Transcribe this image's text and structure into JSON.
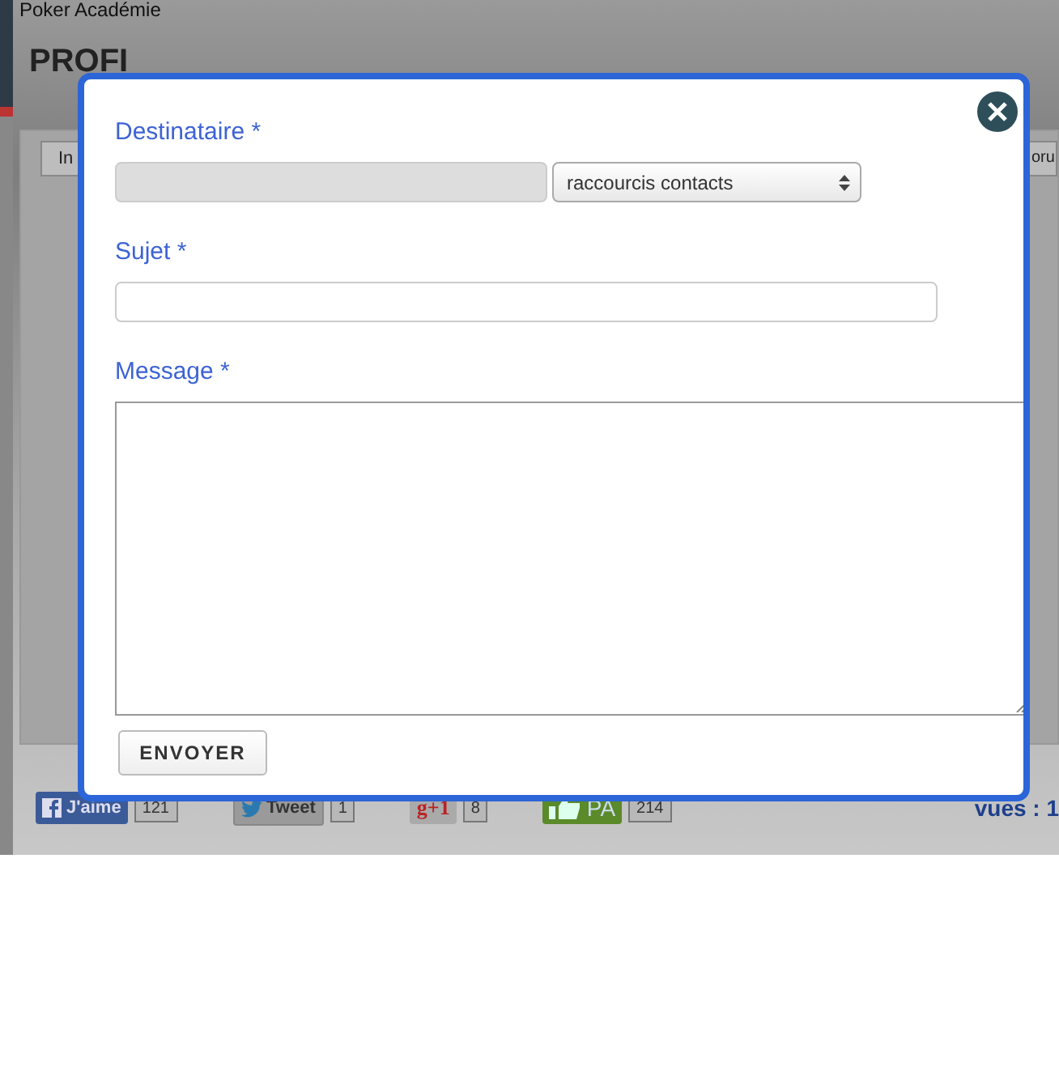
{
  "page": {
    "site_title": "Poker Académie",
    "heading": "PROFI",
    "tabs": [
      {
        "label": "In"
      },
      {
        "label": "oru"
      }
    ]
  },
  "social": [
    {
      "kind": "facebook",
      "label": "J'aime",
      "count": "121"
    },
    {
      "kind": "twitter",
      "label": "Tweet",
      "count": "1"
    },
    {
      "kind": "gplus",
      "label": "g+1",
      "count": "8"
    },
    {
      "kind": "pa",
      "label": "PA",
      "count": "214"
    }
  ],
  "views": {
    "label": "vues : 1"
  },
  "modal": {
    "fields": [
      {
        "kind": "recipient",
        "label": "Destinataire *",
        "select": "raccourcis contacts"
      },
      {
        "kind": "subject",
        "label": "Sujet *"
      },
      {
        "kind": "message",
        "label": "Message *"
      }
    ],
    "submit": "ENVOYER"
  }
}
